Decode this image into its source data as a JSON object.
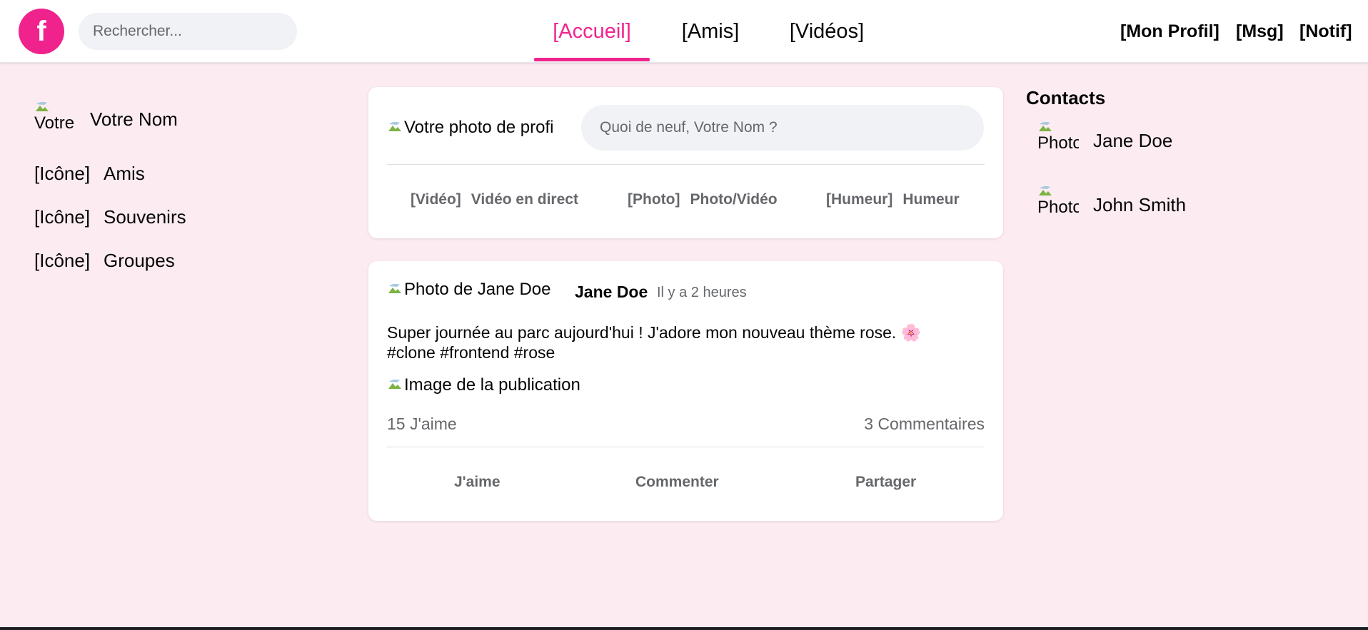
{
  "header": {
    "logo_text": "f",
    "search_placeholder": "Rechercher...",
    "tabs": [
      {
        "label": "[Accueil]",
        "active": true
      },
      {
        "label": "[Amis]",
        "active": false
      },
      {
        "label": "[Vidéos]",
        "active": false
      }
    ],
    "right_links": [
      "[Mon Profil]",
      "[Msg]",
      "[Notif]"
    ]
  },
  "sidebar": {
    "profile_alt": "Votre",
    "profile_name": "Votre Nom",
    "items": [
      {
        "icon_label": "[Icône]",
        "label": "Amis"
      },
      {
        "icon_label": "[Icône]",
        "label": "Souvenirs"
      },
      {
        "icon_label": "[Icône]",
        "label": "Groupes"
      }
    ]
  },
  "composer": {
    "avatar_alt": "Votre photo de profil",
    "placeholder": "Quoi de neuf, Votre Nom ?",
    "actions": [
      {
        "tag": "[Vidéo]",
        "label": "Vidéo en direct"
      },
      {
        "tag": "[Photo]",
        "label": "Photo/Vidéo"
      },
      {
        "tag": "[Humeur]",
        "label": "Humeur"
      }
    ]
  },
  "post": {
    "avatar_alt": "Photo de Jane Doe",
    "author": "Jane Doe",
    "time": "Il y a 2 heures",
    "text_line1": "Super journée au parc aujourd'hui ! J'adore mon nouveau thème rose. 🌸",
    "text_line2": "#clone #frontend #rose",
    "image_alt": "Image de la publication",
    "likes": "15 J'aime",
    "comments": "3 Commentaires",
    "actions": [
      "J'aime",
      "Commenter",
      "Partager"
    ]
  },
  "contacts": {
    "title": "Contacts",
    "items": [
      {
        "alt": "Photo",
        "name": "Jane Doe"
      },
      {
        "alt": "Photo",
        "name": "John Smith"
      }
    ]
  },
  "colors": {
    "accent": "#f0238d",
    "page_bg": "#fcecf1",
    "card_bg": "#ffffff",
    "muted_text": "#65676b"
  }
}
